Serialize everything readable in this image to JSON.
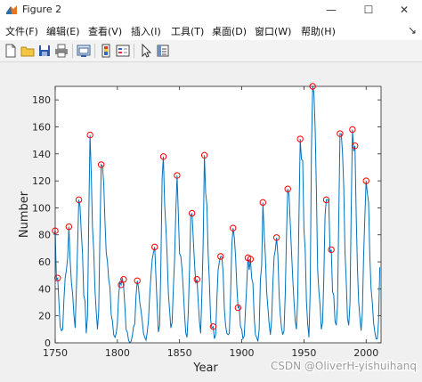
{
  "window": {
    "title": "Figure 2"
  },
  "menu": [
    "文件(F)",
    "编辑(E)",
    "查看(V)",
    "插入(I)",
    "工具(T)",
    "桌面(D)",
    "窗口(W)",
    "帮助(H)"
  ],
  "toolbar": [
    "new-figure",
    "open-file",
    "save",
    "print",
    "link-axes",
    "insert-colorbar",
    "insert-legend",
    "edit-plot",
    "property-inspector"
  ],
  "watermark": "CSDN @OliverH-yishuihanq",
  "chart_data": {
    "type": "line",
    "xlabel": "Year",
    "ylabel": "Number",
    "xlim": [
      1750,
      2012
    ],
    "ylim": [
      0,
      190
    ],
    "xticks": [
      1750,
      1800,
      1850,
      1900,
      1950,
      2000
    ],
    "yticks": [
      0,
      20,
      40,
      60,
      80,
      100,
      120,
      140,
      160,
      180
    ],
    "line_color": "#0072bd",
    "marker_color": "#ff0000",
    "series": [
      {
        "values": [
          [
            1749,
            80
          ],
          [
            1750,
            83
          ],
          [
            1751,
            47
          ],
          [
            1752,
            48
          ],
          [
            1753,
            30
          ],
          [
            1754,
            12
          ],
          [
            1755,
            9
          ],
          [
            1756,
            10
          ],
          [
            1757,
            32
          ],
          [
            1758,
            48
          ],
          [
            1759,
            54
          ],
          [
            1760,
            63
          ],
          [
            1761,
            86
          ],
          [
            1762,
            61
          ],
          [
            1763,
            45
          ],
          [
            1764,
            36
          ],
          [
            1765,
            21
          ],
          [
            1766,
            11
          ],
          [
            1767,
            38
          ],
          [
            1768,
            70
          ],
          [
            1769,
            106
          ],
          [
            1770,
            101
          ],
          [
            1771,
            82
          ],
          [
            1772,
            66
          ],
          [
            1773,
            35
          ],
          [
            1774,
            31
          ],
          [
            1775,
            7
          ],
          [
            1776,
            20
          ],
          [
            1777,
            93
          ],
          [
            1778,
            154
          ],
          [
            1779,
            126
          ],
          [
            1780,
            85
          ],
          [
            1781,
            68
          ],
          [
            1782,
            39
          ],
          [
            1783,
            23
          ],
          [
            1784,
            10
          ],
          [
            1785,
            24
          ],
          [
            1786,
            83
          ],
          [
            1787,
            132
          ],
          [
            1788,
            131
          ],
          [
            1789,
            118
          ],
          [
            1790,
            90
          ],
          [
            1791,
            67
          ],
          [
            1792,
            60
          ],
          [
            1793,
            47
          ],
          [
            1794,
            41
          ],
          [
            1795,
            21
          ],
          [
            1796,
            16
          ],
          [
            1797,
            6
          ],
          [
            1798,
            4
          ],
          [
            1799,
            7
          ],
          [
            1800,
            14
          ],
          [
            1801,
            34
          ],
          [
            1802,
            45
          ],
          [
            1803,
            43
          ],
          [
            1804,
            48
          ],
          [
            1805,
            42
          ],
          [
            1806,
            28
          ],
          [
            1807,
            10
          ],
          [
            1808,
            8
          ],
          [
            1809,
            2
          ],
          [
            1810,
            0
          ],
          [
            1811,
            1
          ],
          [
            1812,
            5
          ],
          [
            1813,
            12
          ],
          [
            1814,
            14
          ],
          [
            1815,
            35
          ],
          [
            1816,
            46
          ],
          [
            1817,
            41
          ],
          [
            1818,
            30
          ],
          [
            1819,
            24
          ],
          [
            1820,
            16
          ],
          [
            1821,
            7
          ],
          [
            1822,
            4
          ],
          [
            1823,
            2
          ],
          [
            1824,
            8
          ],
          [
            1825,
            17
          ],
          [
            1826,
            36
          ],
          [
            1827,
            50
          ],
          [
            1828,
            62
          ],
          [
            1829,
            67
          ],
          [
            1830,
            71
          ],
          [
            1831,
            48
          ],
          [
            1832,
            28
          ],
          [
            1833,
            8
          ],
          [
            1834,
            13
          ],
          [
            1835,
            57
          ],
          [
            1836,
            122
          ],
          [
            1837,
            138
          ],
          [
            1838,
            103
          ],
          [
            1839,
            86
          ],
          [
            1840,
            65
          ],
          [
            1841,
            37
          ],
          [
            1842,
            24
          ],
          [
            1843,
            11
          ],
          [
            1844,
            15
          ],
          [
            1845,
            40
          ],
          [
            1846,
            62
          ],
          [
            1847,
            98
          ],
          [
            1848,
            124
          ],
          [
            1849,
            96
          ],
          [
            1850,
            66
          ],
          [
            1851,
            64
          ],
          [
            1852,
            54
          ],
          [
            1853,
            39
          ],
          [
            1854,
            21
          ],
          [
            1855,
            7
          ],
          [
            1856,
            4
          ],
          [
            1857,
            23
          ],
          [
            1858,
            55
          ],
          [
            1859,
            94
          ],
          [
            1860,
            96
          ],
          [
            1861,
            77
          ],
          [
            1862,
            59
          ],
          [
            1863,
            44
          ],
          [
            1864,
            47
          ],
          [
            1865,
            31
          ],
          [
            1866,
            16
          ],
          [
            1867,
            7
          ],
          [
            1868,
            37
          ],
          [
            1869,
            74
          ],
          [
            1870,
            139
          ],
          [
            1871,
            111
          ],
          [
            1872,
            102
          ],
          [
            1873,
            66
          ],
          [
            1874,
            45
          ],
          [
            1875,
            17
          ],
          [
            1876,
            11
          ],
          [
            1877,
            12
          ],
          [
            1878,
            3
          ],
          [
            1879,
            6
          ],
          [
            1880,
            32
          ],
          [
            1881,
            54
          ],
          [
            1882,
            60
          ],
          [
            1883,
            64
          ],
          [
            1884,
            64
          ],
          [
            1885,
            52
          ],
          [
            1886,
            25
          ],
          [
            1887,
            13
          ],
          [
            1888,
            7
          ],
          [
            1889,
            6
          ],
          [
            1890,
            7
          ],
          [
            1891,
            36
          ],
          [
            1892,
            73
          ],
          [
            1893,
            85
          ],
          [
            1894,
            78
          ],
          [
            1895,
            64
          ],
          [
            1896,
            42
          ],
          [
            1897,
            26
          ],
          [
            1898,
            27
          ],
          [
            1899,
            12
          ],
          [
            1900,
            10
          ],
          [
            1901,
            3
          ],
          [
            1902,
            5
          ],
          [
            1903,
            24
          ],
          [
            1904,
            42
          ],
          [
            1905,
            63
          ],
          [
            1906,
            54
          ],
          [
            1907,
            62
          ],
          [
            1908,
            48
          ],
          [
            1909,
            44
          ],
          [
            1910,
            19
          ],
          [
            1911,
            6
          ],
          [
            1912,
            4
          ],
          [
            1913,
            1
          ],
          [
            1914,
            10
          ],
          [
            1915,
            47
          ],
          [
            1916,
            57
          ],
          [
            1917,
            104
          ],
          [
            1918,
            81
          ],
          [
            1919,
            64
          ],
          [
            1920,
            38
          ],
          [
            1921,
            26
          ],
          [
            1922,
            14
          ],
          [
            1923,
            6
          ],
          [
            1924,
            17
          ],
          [
            1925,
            44
          ],
          [
            1926,
            64
          ],
          [
            1927,
            69
          ],
          [
            1928,
            78
          ],
          [
            1929,
            65
          ],
          [
            1930,
            36
          ],
          [
            1931,
            21
          ],
          [
            1932,
            11
          ],
          [
            1933,
            6
          ],
          [
            1934,
            9
          ],
          [
            1935,
            36
          ],
          [
            1936,
            80
          ],
          [
            1937,
            114
          ],
          [
            1938,
            110
          ],
          [
            1939,
            89
          ],
          [
            1940,
            68
          ],
          [
            1941,
            48
          ],
          [
            1942,
            31
          ],
          [
            1943,
            16
          ],
          [
            1944,
            10
          ],
          [
            1945,
            33
          ],
          [
            1946,
            93
          ],
          [
            1947,
            151
          ],
          [
            1948,
            136
          ],
          [
            1949,
            135
          ],
          [
            1950,
            84
          ],
          [
            1951,
            69
          ],
          [
            1952,
            31
          ],
          [
            1953,
            14
          ],
          [
            1954,
            4
          ],
          [
            1955,
            38
          ],
          [
            1956,
            142
          ],
          [
            1957,
            190
          ],
          [
            1958,
            185
          ],
          [
            1959,
            159
          ],
          [
            1960,
            112
          ],
          [
            1961,
            54
          ],
          [
            1962,
            38
          ],
          [
            1963,
            28
          ],
          [
            1964,
            10
          ],
          [
            1965,
            15
          ],
          [
            1966,
            47
          ],
          [
            1967,
            94
          ],
          [
            1968,
            106
          ],
          [
            1969,
            106
          ],
          [
            1970,
            105
          ],
          [
            1971,
            67
          ],
          [
            1972,
            69
          ],
          [
            1973,
            38
          ],
          [
            1974,
            35
          ],
          [
            1975,
            16
          ],
          [
            1976,
            13
          ],
          [
            1977,
            28
          ],
          [
            1978,
            93
          ],
          [
            1979,
            155
          ],
          [
            1980,
            155
          ],
          [
            1981,
            141
          ],
          [
            1982,
            116
          ],
          [
            1983,
            67
          ],
          [
            1984,
            46
          ],
          [
            1985,
            18
          ],
          [
            1986,
            13
          ],
          [
            1987,
            29
          ],
          [
            1988,
            100
          ],
          [
            1989,
            158
          ],
          [
            1990,
            142
          ],
          [
            1991,
            146
          ],
          [
            1992,
            94
          ],
          [
            1993,
            55
          ],
          [
            1994,
            30
          ],
          [
            1995,
            18
          ],
          [
            1996,
            9
          ],
          [
            1997,
            22
          ],
          [
            1998,
            64
          ],
          [
            1999,
            93
          ],
          [
            2000,
            120
          ],
          [
            2001,
            111
          ],
          [
            2002,
            104
          ],
          [
            2003,
            64
          ],
          [
            2004,
            40
          ],
          [
            2005,
            30
          ],
          [
            2006,
            15
          ],
          [
            2007,
            8
          ],
          [
            2008,
            3
          ],
          [
            2009,
            3
          ],
          [
            2010,
            16
          ],
          [
            2011,
            56
          ]
        ]
      }
    ],
    "peaks": [
      [
        1750,
        83
      ],
      [
        1752,
        48
      ],
      [
        1761,
        86
      ],
      [
        1769,
        106
      ],
      [
        1778,
        154
      ],
      [
        1787,
        132
      ],
      [
        1803,
        43
      ],
      [
        1805,
        47
      ],
      [
        1816,
        46
      ],
      [
        1830,
        71
      ],
      [
        1837,
        138
      ],
      [
        1848,
        124
      ],
      [
        1860,
        96
      ],
      [
        1864,
        47
      ],
      [
        1870,
        139
      ],
      [
        1877,
        12
      ],
      [
        1883,
        64
      ],
      [
        1893,
        85
      ],
      [
        1897,
        26
      ],
      [
        1905,
        63
      ],
      [
        1907,
        62
      ],
      [
        1917,
        104
      ],
      [
        1928,
        78
      ],
      [
        1937,
        114
      ],
      [
        1947,
        151
      ],
      [
        1957,
        190
      ],
      [
        1968,
        106
      ],
      [
        1972,
        69
      ],
      [
        1979,
        155
      ],
      [
        1989,
        158
      ],
      [
        1991,
        146
      ],
      [
        2000,
        120
      ]
    ]
  }
}
